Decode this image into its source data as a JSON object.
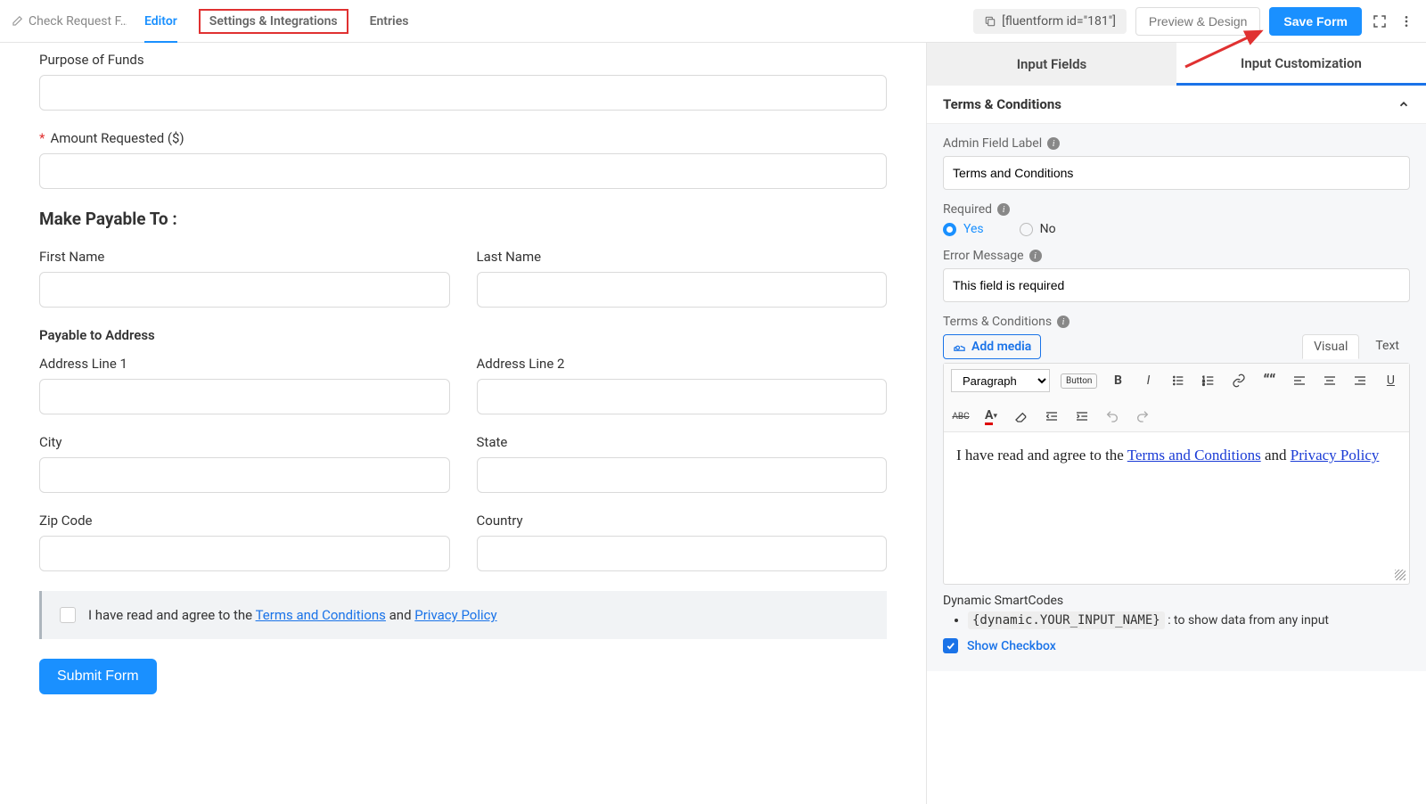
{
  "header": {
    "formName": "Check Request F…",
    "tabs": {
      "editor": "Editor",
      "settings": "Settings & Integrations",
      "entries": "Entries"
    },
    "shortcode": "[fluentform id=\"181\"]",
    "previewDesign": "Preview & Design",
    "saveForm": "Save Form"
  },
  "form": {
    "purposeLabel": "Purpose of Funds",
    "amountLabel": "Amount Requested ($)",
    "payableTitle": "Make Payable To :",
    "firstName": "First Name",
    "lastName": "Last Name",
    "payableAddress": "Payable to Address",
    "addr1": "Address Line 1",
    "addr2": "Address Line 2",
    "city": "City",
    "state": "State",
    "zip": "Zip Code",
    "country": "Country",
    "termsPrefix": "I have read and agree to the ",
    "termsLink1": "Terms and Conditions",
    "termsMid": " and ",
    "termsLink2": "Privacy Policy",
    "submit": "Submit Form"
  },
  "panel": {
    "tabs": {
      "fields": "Input Fields",
      "custom": "Input Customization"
    },
    "sectionTitle": "Terms & Conditions",
    "adminLabel": "Admin Field Label",
    "adminValue": "Terms and Conditions",
    "requiredLabel": "Required",
    "yes": "Yes",
    "no": "No",
    "errorLabel": "Error Message",
    "errorValue": "This field is required",
    "termsLabel": "Terms & Conditions",
    "addMedia": "Add media",
    "tabVisual": "Visual",
    "tabText": "Text",
    "paragraph": "Paragraph",
    "buttonLabel": "Button",
    "editorText": "I have read and agree to the ",
    "editorLink1": "Terms and Conditions",
    "editorMid": " and ",
    "editorLink2": "Privacy Policy",
    "smartTitle": "Dynamic SmartCodes",
    "smartCode": "{dynamic.YOUR_INPUT_NAME}",
    "smartDesc": " : to show data from any input",
    "showCheckbox": "Show Checkbox"
  }
}
